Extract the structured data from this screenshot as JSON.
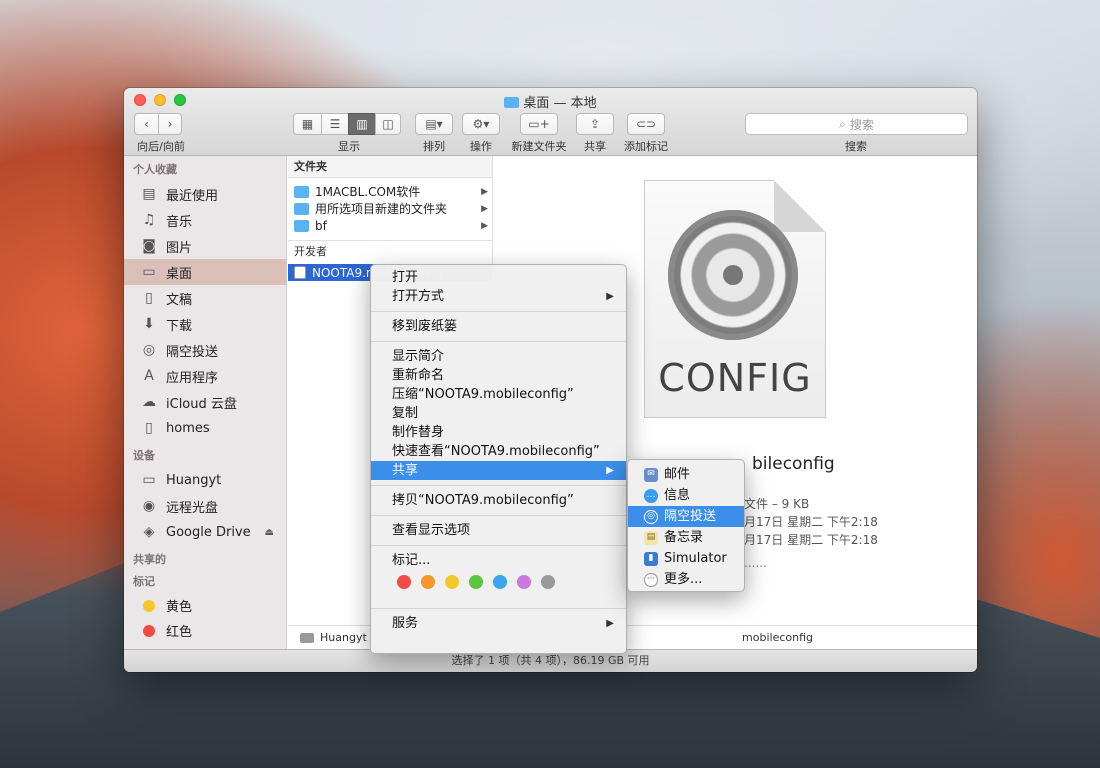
{
  "window": {
    "title": "桌面 — 本地"
  },
  "toolbar": {
    "nav_label": "向后/向前",
    "view_label": "显示",
    "arrange_label": "排列",
    "action_label": "操作",
    "newfolder_label": "新建文件夹",
    "share_label": "共享",
    "tag_label": "添加标记",
    "search_placeholder": "搜索",
    "search_label": "搜索"
  },
  "sidebar": {
    "favorites_header": "个人收藏",
    "favorites": [
      {
        "label": "最近使用",
        "icon": "recents-icon"
      },
      {
        "label": "音乐",
        "icon": "music-icon"
      },
      {
        "label": "图片",
        "icon": "camera-icon"
      },
      {
        "label": "桌面",
        "icon": "desktop-icon"
      },
      {
        "label": "文稿",
        "icon": "documents-icon"
      },
      {
        "label": "下载",
        "icon": "downloads-icon"
      },
      {
        "label": "隔空投送",
        "icon": "airdrop-icon"
      },
      {
        "label": "应用程序",
        "icon": "applications-icon"
      },
      {
        "label": "iCloud 云盘",
        "icon": "cloud-icon"
      },
      {
        "label": "homes",
        "icon": "document-icon"
      }
    ],
    "devices_header": "设备",
    "devices": [
      {
        "label": "Huangyt",
        "icon": "computer-icon"
      },
      {
        "label": "远程光盘",
        "icon": "disc-icon"
      },
      {
        "label": "Google Drive",
        "icon": "drive-icon"
      }
    ],
    "shared_header": "共享的",
    "tags_header": "标记",
    "tags": [
      {
        "label": "黄色",
        "color": "#f5c728"
      },
      {
        "label": "红色",
        "color": "#f04b44"
      }
    ]
  },
  "column1": {
    "header": "文件夹",
    "folders": [
      {
        "name": "1MACBL.COM软件"
      },
      {
        "name": "用所选项目新建的文件夹"
      },
      {
        "name": "bf"
      }
    ],
    "developer_header": "开发者",
    "selected_file": "NOOTA9.mobileconfig"
  },
  "preview": {
    "icon_text": "CONFIG",
    "name_suffix": "bileconfig",
    "meta_kind": "文件 – 9 KB",
    "meta_created": "月17日 星期二 下午2:18",
    "meta_modified": "月17日 星期二 下午2:18",
    "more_dots": "......"
  },
  "pathbar": {
    "disk": "Huangyt",
    "file_tail": "mobileconfig"
  },
  "statusbar": {
    "text": "选择了 1 项（共 4 项），86.19 GB 可用"
  },
  "context_menu": {
    "open": "打开",
    "open_with": "打开方式",
    "move_trash": "移到废纸篓",
    "get_info": "显示简介",
    "rename": "重新命名",
    "compress": "压缩“NOOTA9.mobileconfig”",
    "duplicate": "复制",
    "make_alias": "制作替身",
    "quick_look": "快速查看“NOOTA9.mobileconfig”",
    "share": "共享",
    "copy": "拷贝“NOOTA9.mobileconfig”",
    "view_options": "查看显示选项",
    "tags": "标记...",
    "tag_colors": [
      "#f04b44",
      "#f7962a",
      "#f5c728",
      "#5cc63c",
      "#3aa6ee",
      "#c978e0",
      "#9a9a9a"
    ],
    "services": "服务"
  },
  "share_submenu": {
    "items": [
      {
        "label": "邮件",
        "icon": "mail-icon"
      },
      {
        "label": "信息",
        "icon": "messages-icon"
      },
      {
        "label": "隔空投送",
        "icon": "airdrop-icon"
      },
      {
        "label": "备忘录",
        "icon": "notes-icon"
      },
      {
        "label": "Simulator",
        "icon": "simulator-icon"
      },
      {
        "label": "更多...",
        "icon": "more-icon"
      }
    ]
  }
}
